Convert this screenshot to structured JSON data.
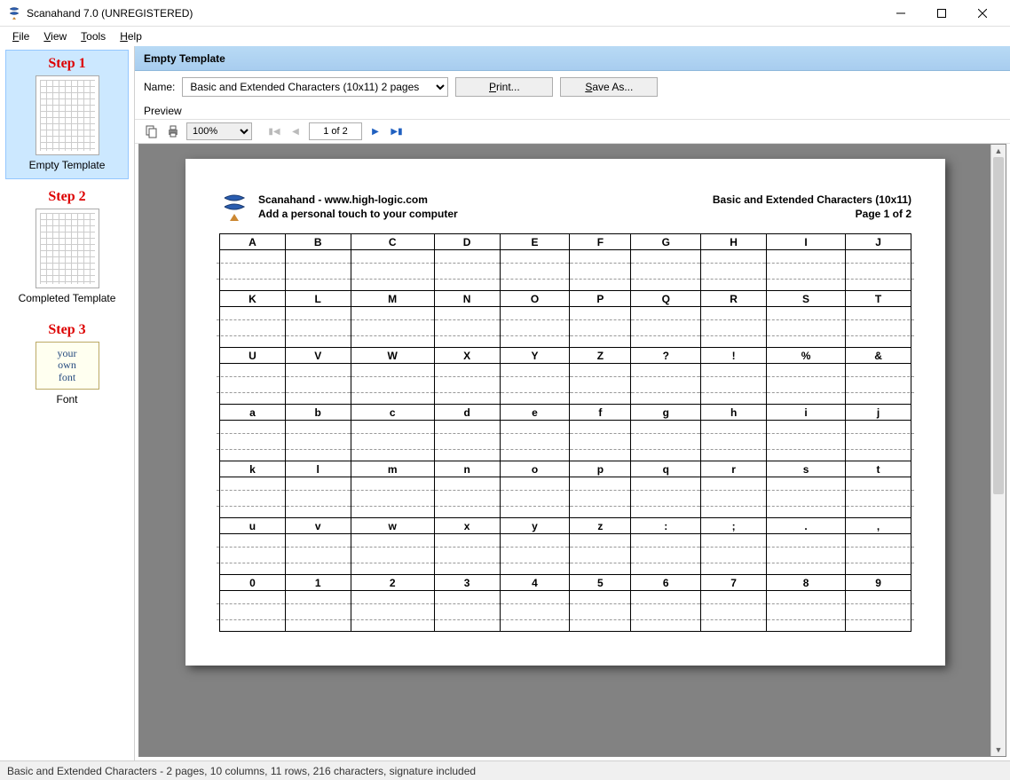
{
  "window": {
    "title": "Scanahand 7.0 (UNREGISTERED)"
  },
  "menu": {
    "file": "File",
    "view": "View",
    "tools": "Tools",
    "help": "Help"
  },
  "sidebar": {
    "steps": [
      {
        "label": "Step 1",
        "name": "Empty Template"
      },
      {
        "label": "Step 2",
        "name": "Completed Template"
      },
      {
        "label": "Step 3",
        "name": "Font"
      }
    ],
    "font_lines": [
      "your",
      "own",
      "font"
    ]
  },
  "header": {
    "title": "Empty Template"
  },
  "name_row": {
    "label": "Name:",
    "value": "Basic and Extended Characters (10x11) 2 pages",
    "print": "Print...",
    "save_as": "Save As..."
  },
  "preview": {
    "label": "Preview",
    "zoom": "100%",
    "page_indicator": "1 of 2"
  },
  "page": {
    "header_line1": "Scanahand - www.high-logic.com",
    "header_line2": "Add a personal touch to your computer",
    "header_right1": "Basic and Extended Characters (10x11)",
    "header_right2": "Page 1 of 2",
    "rows": [
      [
        "A",
        "B",
        "C",
        "D",
        "E",
        "F",
        "G",
        "H",
        "I",
        "J"
      ],
      [
        "K",
        "L",
        "M",
        "N",
        "O",
        "P",
        "Q",
        "R",
        "S",
        "T"
      ],
      [
        "U",
        "V",
        "W",
        "X",
        "Y",
        "Z",
        "?",
        "!",
        "%",
        "&"
      ],
      [
        "a",
        "b",
        "c",
        "d",
        "e",
        "f",
        "g",
        "h",
        "i",
        "j"
      ],
      [
        "k",
        "l",
        "m",
        "n",
        "o",
        "p",
        "q",
        "r",
        "s",
        "t"
      ],
      [
        "u",
        "v",
        "w",
        "x",
        "y",
        "z",
        ":",
        ";",
        ".",
        ","
      ],
      [
        "0",
        "1",
        "2",
        "3",
        "4",
        "5",
        "6",
        "7",
        "8",
        "9"
      ]
    ]
  },
  "statusbar": {
    "text": "Basic and Extended Characters - 2 pages, 10 columns, 11 rows, 216 characters, signature included"
  }
}
